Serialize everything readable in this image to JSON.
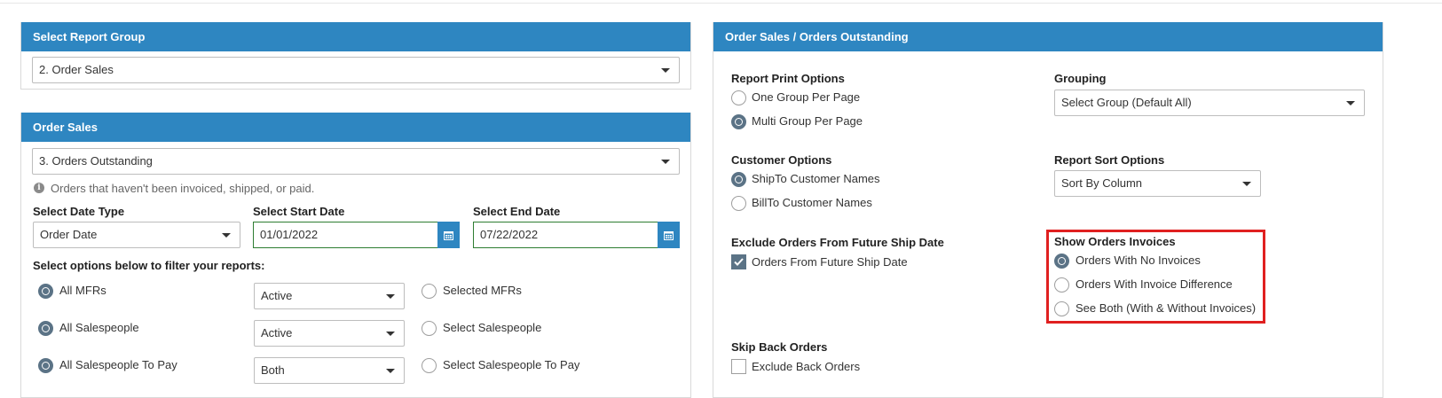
{
  "report_group": {
    "header": "Select Report Group",
    "selected": "2. Order Sales"
  },
  "order_sales": {
    "header": "Order Sales",
    "report_selected": "3. Orders Outstanding",
    "info_text": "Orders that haven't been invoiced, shipped, or paid.",
    "date_type_label": "Select Date Type",
    "date_type_value": "Order Date",
    "start_date_label": "Select Start Date",
    "start_date_value": "01/01/2022",
    "end_date_label": "Select End Date",
    "end_date_value": "07/22/2022",
    "filter_label": "Select options below to filter your reports:",
    "filters": [
      {
        "all_label": "All MFRs",
        "status": "Active",
        "select_label": "Selected MFRs"
      },
      {
        "all_label": "All Salespeople",
        "status": "Active",
        "select_label": "Select Salespeople"
      },
      {
        "all_label": "All Salespeople To Pay",
        "status": "Both",
        "select_label": "Select Salespeople To Pay"
      }
    ]
  },
  "outstanding": {
    "header": "Order Sales / Orders Outstanding",
    "print_options_label": "Report Print Options",
    "print_options": [
      "One Group Per Page",
      "Multi Group Per Page"
    ],
    "grouping_label": "Grouping",
    "grouping_value": "Select Group (Default All)",
    "customer_options_label": "Customer Options",
    "customer_options": [
      "ShipTo Customer Names",
      "BillTo Customer Names"
    ],
    "sort_label": "Report Sort Options",
    "sort_value": "Sort By Column",
    "exclude_future_label": "Exclude Orders From Future Ship Date",
    "exclude_future_option": "Orders From Future Ship Date",
    "show_invoices_label": "Show Orders Invoices",
    "show_invoices_options": [
      "Orders With No Invoices",
      "Orders With Invoice Difference",
      "See Both (With & Without Invoices)"
    ],
    "skip_back_label": "Skip Back Orders",
    "skip_back_option": "Exclude Back Orders"
  },
  "colors": {
    "header_blue": "#2e86c1",
    "radio_checked": "#5b7386",
    "highlight_red": "#e02020",
    "date_border_green": "#2e7d32"
  }
}
